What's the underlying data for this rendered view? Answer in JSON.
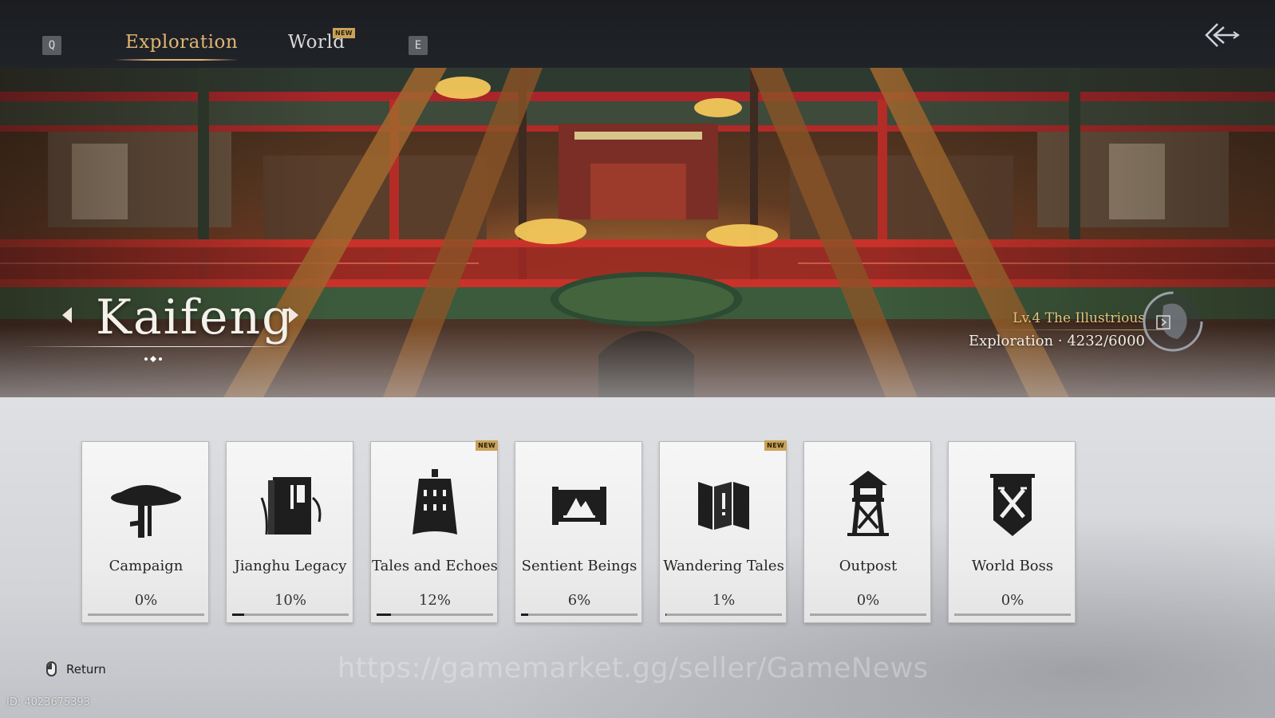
{
  "header": {
    "prev_key": "Q",
    "next_key": "E",
    "tabs": [
      {
        "label": "Exploration",
        "active": true
      },
      {
        "label": "World",
        "active": false,
        "badge": "NEW"
      }
    ],
    "back_icon": "double-chevron-left-icon"
  },
  "banner": {
    "city_name": "Kaifeng",
    "level_label": "Lv.4 The Illustrious",
    "exploration_label": "Exploration · 4232/6000",
    "emblem_icon": "region-emblem-icon"
  },
  "categories": [
    {
      "title": "Campaign",
      "percent_label": "0%",
      "progress": 0,
      "icon": "straw-hat-icon",
      "badge": ""
    },
    {
      "title": "Jianghu Legacy",
      "percent_label": "10%",
      "progress": 0.1,
      "icon": "book-icon",
      "badge": ""
    },
    {
      "title": "Tales and Echoes",
      "percent_label": "12%",
      "progress": 0.12,
      "icon": "bell-icon",
      "badge": "NEW"
    },
    {
      "title": "Sentient Beings",
      "percent_label": "6%",
      "progress": 0.06,
      "icon": "scroll-painting-icon",
      "badge": ""
    },
    {
      "title": "Wandering Tales",
      "percent_label": "1%",
      "progress": 0.01,
      "icon": "folding-screen-icon",
      "badge": "NEW"
    },
    {
      "title": "Outpost",
      "percent_label": "0%",
      "progress": 0,
      "icon": "watchtower-icon",
      "badge": ""
    },
    {
      "title": "World Boss",
      "percent_label": "0%",
      "progress": 0,
      "icon": "crossed-swords-banner-icon",
      "badge": ""
    }
  ],
  "footer": {
    "return_label": "Return",
    "return_icon": "mouse-right-click-icon",
    "watermark": "https://gamemarket.gg/seller/GameNews",
    "player_id": "ID: 4023675393"
  },
  "colors": {
    "accent_gold": "#e0b574",
    "level_gold": "#e7c37f",
    "topbar": "#1e2024"
  }
}
